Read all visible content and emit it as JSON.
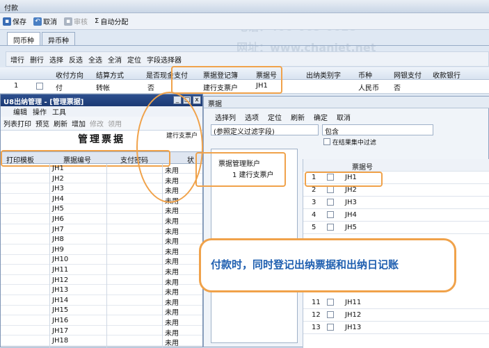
{
  "window_title": "付款",
  "toolbar1": {
    "save": "保存",
    "cancel": "取消",
    "note": "审核",
    "auto_assign": "自动分配"
  },
  "tabs": [
    "同币种",
    "异币种"
  ],
  "toolbar2": [
    "增行",
    "删行",
    "选择",
    "反选",
    "全选",
    "全消",
    "定位",
    "字段选择器"
  ],
  "grid1": {
    "headers": [
      "收付方向",
      "结算方式",
      "是否现金支付",
      "票据登记簿",
      "票据号",
      "出纳类别字",
      "币种",
      "网银支付",
      "收款银行"
    ],
    "row": {
      "index": "1",
      "direction": "付",
      "method": "转帐",
      "cash": "否",
      "register": "建行支票户",
      "bill_no": "JH1",
      "currency": "人民币",
      "netbank": "否"
    }
  },
  "left_window": {
    "title": "U8出纳管理 - [管理票据]",
    "menu": [
      "编辑",
      "操作",
      "工具"
    ],
    "tools": [
      "列表打印",
      "预览",
      "刷新",
      "增加",
      "修改",
      "领用"
    ],
    "heading": "管理票据",
    "bank": "建行支票户",
    "headers": [
      "打印模板",
      "票据编号",
      "支付密码",
      "状"
    ],
    "rows": [
      "JH1",
      "JH2",
      "JH3",
      "JH4",
      "JH5",
      "JH6",
      "JH7",
      "JH8",
      "JH9",
      "JH10",
      "JH11",
      "JH12",
      "JH13",
      "JH14",
      "JH15",
      "JH16",
      "JH17",
      "JH18"
    ],
    "status": "未用"
  },
  "right_window": {
    "title": "票据",
    "menu": [
      "选择列",
      "选项",
      "定位",
      "刷新",
      "确定",
      "取消"
    ],
    "filter_field": "(参照定义过滤字段)",
    "filter_op": "包含",
    "filter_check": "在结果集中过滤",
    "tree_root": "票据管理账户",
    "tree_child": "1 建行支票户",
    "column": "票据号",
    "rows": [
      {
        "n": "1",
        "v": "JH1"
      },
      {
        "n": "2",
        "v": "JH2"
      },
      {
        "n": "3",
        "v": "JH3"
      },
      {
        "n": "4",
        "v": "JH4"
      },
      {
        "n": "5",
        "v": "JH5"
      },
      {
        "n": "11",
        "v": "JH11"
      },
      {
        "n": "12",
        "v": "JH12"
      },
      {
        "n": "13",
        "v": "JH13"
      }
    ]
  },
  "callout": "付款时，同时登记出纳票据和出纳日记账",
  "watermark": {
    "phone": "电话：400-665-0028",
    "site": "网址：www.chanjet.net"
  }
}
